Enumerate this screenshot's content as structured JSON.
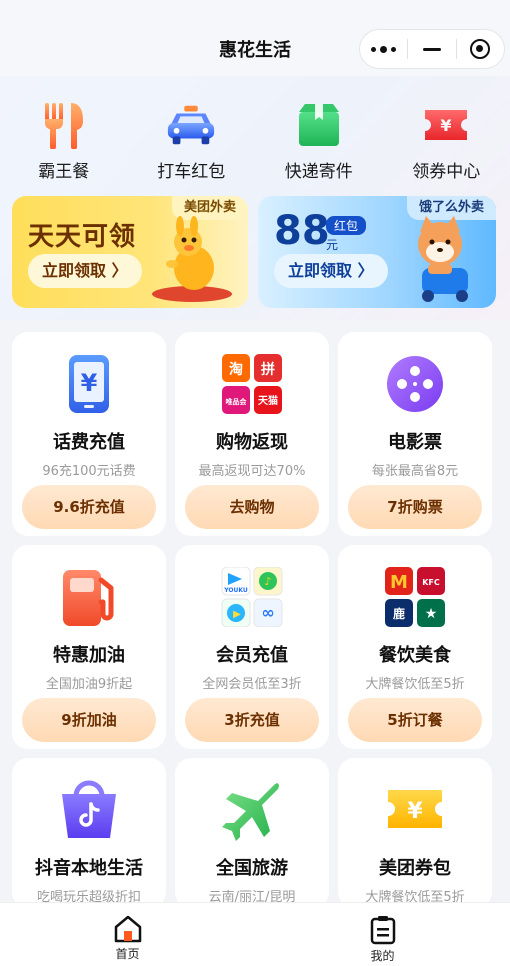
{
  "header": {
    "title": "惠花生活"
  },
  "quick_entries": [
    {
      "label": "霸王餐",
      "icon": "fork-knife-icon"
    },
    {
      "label": "打车红包",
      "icon": "taxi-icon"
    },
    {
      "label": "快递寄件",
      "icon": "parcel-box-icon"
    },
    {
      "label": "领券中心",
      "icon": "coupon-ticket-icon"
    }
  ],
  "banners": {
    "meituan": {
      "tag": "美团外卖",
      "headline": "天天可领",
      "button": "立即领取 〉"
    },
    "eleme": {
      "tag": "饿了么外卖",
      "amount": "88",
      "badge": "红包",
      "unit": "元",
      "button": "立即领取 〉"
    }
  },
  "cards": [
    {
      "title": "话费充值",
      "subtitle": "96充100元话费",
      "button": "9.6折充值",
      "icon": "phone-yuan-icon"
    },
    {
      "title": "购物返现",
      "subtitle": "最高返现可达70%",
      "button": "去购物",
      "icon": "shopping-apps-icon",
      "apps": [
        "淘",
        "拼",
        "唯品会",
        "天猫"
      ]
    },
    {
      "title": "电影票",
      "subtitle": "每张最高省8元",
      "button": "7折购票",
      "icon": "film-reel-icon"
    },
    {
      "title": "特惠加油",
      "subtitle": "全国加油9折起",
      "button": "9折加油",
      "icon": "gas-pump-icon"
    },
    {
      "title": "会员充值",
      "subtitle": "全网会员低至3折",
      "button": "3折充值",
      "icon": "video-apps-icon",
      "apps": [
        "YOUKU",
        "♪",
        "▶",
        "∞"
      ]
    },
    {
      "title": "餐饮美食",
      "subtitle": "大牌餐饮低至5折",
      "button": "5折订餐",
      "icon": "restaurant-brands-icon",
      "apps": [
        "M",
        "KFC",
        "鹿",
        "★"
      ]
    },
    {
      "title": "抖音本地生活",
      "subtitle": "吃喝玩乐超级折扣",
      "icon": "douyin-bag-icon"
    },
    {
      "title": "全国旅游",
      "subtitle": "云南/丽江/昆明",
      "icon": "airplane-icon"
    },
    {
      "title": "美团券包",
      "subtitle": "大牌餐饮低至5折",
      "icon": "yuan-ticket-icon"
    }
  ],
  "tabbar": {
    "home": "首页",
    "mine": "我的"
  }
}
